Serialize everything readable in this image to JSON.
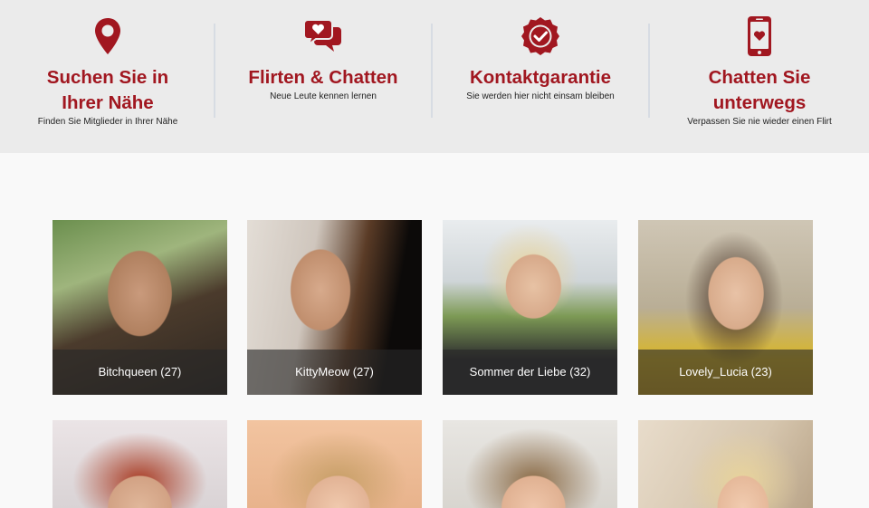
{
  "features": [
    {
      "icon": "map-pin-icon",
      "title_line1": "Suchen Sie in",
      "title_line2": "Ihrer Nähe",
      "subtitle": "Finden Sie Mitglieder in Ihrer Nähe"
    },
    {
      "icon": "chat-heart-icon",
      "title_line1": "Flirten & Chatten",
      "title_line2": "",
      "subtitle": "Neue Leute kennen lernen"
    },
    {
      "icon": "guarantee-badge-icon",
      "title_line1": "Kontaktgarantie",
      "title_line2": "",
      "subtitle": "Sie werden hier nicht einsam bleiben"
    },
    {
      "icon": "phone-heart-icon",
      "title_line1": "Chatten Sie",
      "title_line2": "unterwegs",
      "subtitle": "Verpassen Sie nie wieder einen Flirt"
    }
  ],
  "profiles": [
    {
      "caption": "Bitchqueen (27)"
    },
    {
      "caption": "KittyMeow (27)"
    },
    {
      "caption": "Sommer der Liebe (32)"
    },
    {
      "caption": "Lovely_Lucia (23)"
    },
    {
      "caption": ""
    },
    {
      "caption": ""
    },
    {
      "caption": ""
    },
    {
      "caption": ""
    }
  ],
  "colors": {
    "accent": "#a11720",
    "band": "#ebebeb",
    "page": "#f9f9f9"
  }
}
